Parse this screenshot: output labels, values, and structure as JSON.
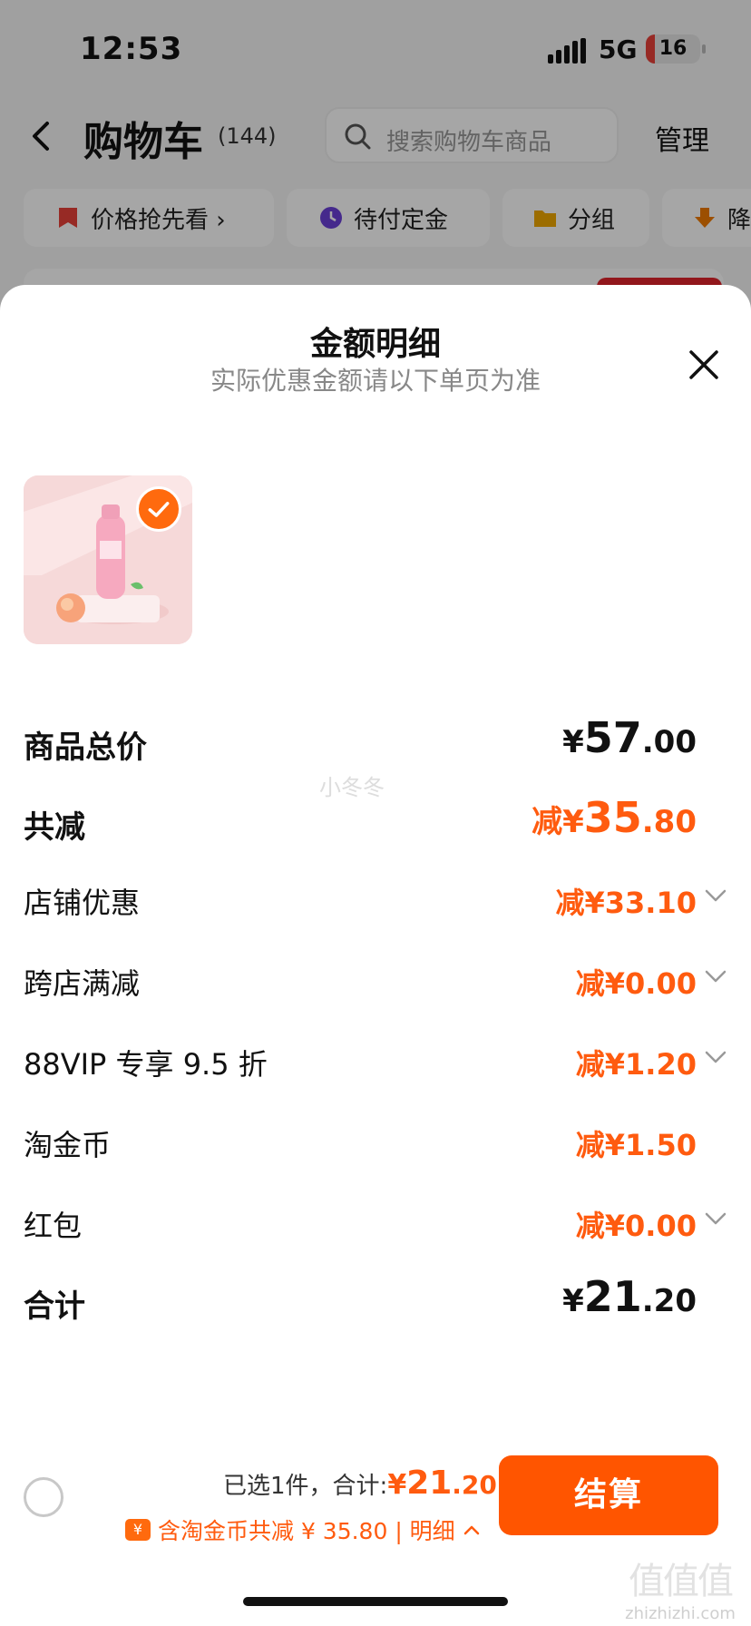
{
  "status_bar": {
    "time": "12:53",
    "network": "5G",
    "battery": "16",
    "battery_level": 0.16
  },
  "nav": {
    "title": "购物车",
    "count": "(144)",
    "search_placeholder": "搜索购物车商品",
    "manage": "管理"
  },
  "chips": [
    {
      "label": "价格抢先看 ›",
      "icon": "price-tag-icon",
      "color": "#e8413a"
    },
    {
      "label": "待付定金",
      "icon": "clock-icon",
      "color": "#6a3fd8"
    },
    {
      "label": "分组",
      "icon": "folder-icon",
      "color": "#f0a800"
    },
    {
      "label": "降",
      "icon": "price-drop-icon",
      "color": "#f07a00"
    }
  ],
  "sheet": {
    "title": "金额明细",
    "subtitle": "实际优惠金额请以下单页为准",
    "watermark": "小冬冬"
  },
  "breakdown": {
    "total_price": {
      "label": "商品总价",
      "currency": "¥",
      "int": "57",
      "dec": ".00"
    },
    "total_discount": {
      "label": "共减",
      "prefix": "减",
      "currency": "¥",
      "int": "35",
      "dec": ".80"
    },
    "items": [
      {
        "label": "店铺优惠",
        "value": "减¥33.10",
        "expandable": true
      },
      {
        "label": "跨店满减",
        "value": "减¥0.00",
        "expandable": true
      },
      {
        "label": "88VIP 专享 9.5 折",
        "value": "减¥1.20",
        "expandable": true
      },
      {
        "label": "淘金币",
        "value": "减¥1.50",
        "expandable": false
      },
      {
        "label": "红包",
        "value": "减¥0.00",
        "expandable": true
      }
    ],
    "sum": {
      "label": "合计",
      "currency": "¥",
      "int": "21",
      "dec": ".20"
    }
  },
  "footer": {
    "selected": "已选1件，合计:",
    "total_currency": "¥",
    "total_int": "21",
    "total_dec": ".20",
    "coin_icon": "¥",
    "discount_text": "含淘金币共减 ¥ 35.80 | 明细",
    "checkout": "结算"
  },
  "site_watermark": {
    "mark": "值值值",
    "url": "zhizhizhi.com"
  },
  "colors": {
    "accent": "#ff5b0f",
    "checkout": "#ff5500"
  }
}
